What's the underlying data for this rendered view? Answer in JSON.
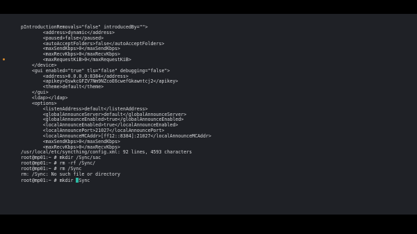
{
  "theme": {
    "background": "#1f2126",
    "letterbox": "#000000",
    "text": "#d8d9dc",
    "cursor": "#2bb8a3",
    "marker": "#d78c2c"
  },
  "terminal": {
    "lines": [
      "pIntroductionRemovals=\"false\" introducedBy=\"\">",
      "        <address>dynamic</address>",
      "        <paused>false</paused>",
      "        <autoAcceptFolders>false</autoAcceptFolders>",
      "        <maxSendKbps>0</maxSendKbps>",
      "        <maxRecvKbps>0</maxRecvKbps>",
      "        <maxRequestKiB>0</maxRequestKiB>",
      "    </device>",
      "    <gui enabled=\"true\" tls=\"false\" debugging=\"false\">",
      "        <address>0.0.0.0:8384</address>",
      "        <apikey>QswkcGFZV7Nm9NZcoE6cwefGkawntcj2</apikey>",
      "        <theme>default</theme>",
      "    </gui>",
      "    <ldap></ldap>",
      "    <options>",
      "        <listenAddress>default</listenAddress>",
      "        <globalAnnounceServer>default</globalAnnounceServer>",
      "        <globalAnnounceEnabled>true</globalAnnounceEnabled>",
      "        <localAnnounceEnabled>true</localAnnounceEnabled>",
      "        <localAnnouncePort>21027</localAnnouncePort>",
      "        <localAnnounceMCAddr>[ff12::8384]:21027</localAnnounceMCAddr>",
      "        <maxSendKbps>0</maxSendKbps>",
      "        <maxRecvKbps>0</maxRecvKbps>",
      "/usr/local/etc/syncthing/config.xml: 92 lines, 4593 characters",
      "root@mp01:~ # mkdir /Sync/sac",
      "root@mp01:~ # rm -rf /Sync/",
      "root@mp01:~ # rm /Sync",
      "rm: /Sync: No such file or directory"
    ],
    "prompt_line": {
      "before_cursor": "root@mp01:~ # mkdir ",
      "after_cursor": "Sync"
    }
  }
}
